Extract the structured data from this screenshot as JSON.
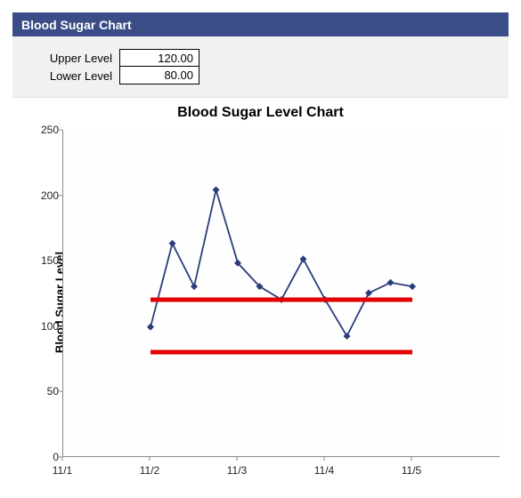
{
  "header": {
    "title": "Blood Sugar Chart"
  },
  "levels": {
    "upper": {
      "label": "Upper Level",
      "value": "120.00"
    },
    "lower": {
      "label": "Lower Level",
      "value": "80.00"
    }
  },
  "chart_data": {
    "type": "line",
    "title": "Blood Sugar Level Chart",
    "ylabel": "Blood Sugar Level",
    "xlabel": "",
    "x_range": [
      0,
      5
    ],
    "y_range": [
      0,
      250
    ],
    "x_ticks": [
      {
        "pos": 0,
        "label": "11/1"
      },
      {
        "pos": 1,
        "label": "11/2"
      },
      {
        "pos": 2,
        "label": "11/3"
      },
      {
        "pos": 3,
        "label": "11/4"
      },
      {
        "pos": 4,
        "label": "11/5"
      }
    ],
    "y_ticks": [
      0,
      50,
      100,
      150,
      200,
      250
    ],
    "reference_lines": [
      {
        "name": "upper",
        "value": 120,
        "color": "#e40000",
        "x_from": 1,
        "x_to": 4
      },
      {
        "name": "lower",
        "value": 80,
        "color": "#e40000",
        "x_from": 1,
        "x_to": 4
      }
    ],
    "series": [
      {
        "name": "Blood Sugar Level",
        "color": "#2a3c7a",
        "points": [
          {
            "x": 1.0,
            "y": 99
          },
          {
            "x": 1.25,
            "y": 163
          },
          {
            "x": 1.5,
            "y": 130
          },
          {
            "x": 1.75,
            "y": 204
          },
          {
            "x": 2.0,
            "y": 148
          },
          {
            "x": 2.25,
            "y": 130
          },
          {
            "x": 2.5,
            "y": 120
          },
          {
            "x": 2.75,
            "y": 151
          },
          {
            "x": 3.0,
            "y": 120
          },
          {
            "x": 3.25,
            "y": 92
          },
          {
            "x": 3.5,
            "y": 125
          },
          {
            "x": 3.75,
            "y": 133
          },
          {
            "x": 4.0,
            "y": 130
          }
        ]
      }
    ]
  }
}
